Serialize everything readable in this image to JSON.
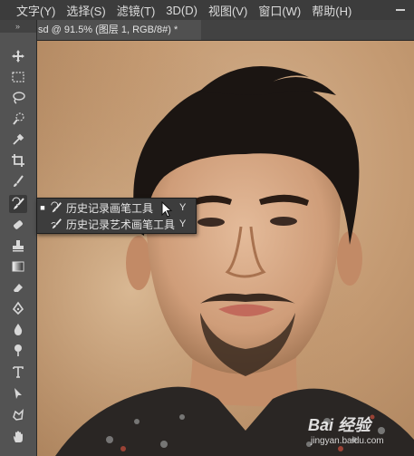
{
  "menubar": {
    "items": [
      "文字(Y)",
      "选择(S)",
      "滤镜(T)",
      "3D(D)",
      "视图(V)",
      "窗口(W)",
      "帮助(H)"
    ]
  },
  "document": {
    "tab_title": "sd @ 91.5% (图层 1, RGB/8#) *"
  },
  "toolbar": {
    "grip": "»",
    "tools": [
      "move-tool",
      "marquee-tool",
      "lasso-tool",
      "quick-select-tool",
      "eyedropper-tool",
      "crop-tool",
      "brush-tool",
      "history-brush-tool",
      "eraser-tool",
      "stamp-tool",
      "gradient-tool",
      "eraser-tool-2",
      "pen-tool",
      "blur-tool",
      "dodge-tool",
      "type-tool",
      "path-select-tool",
      "shape-tool",
      "hand-tool"
    ]
  },
  "flyout": {
    "items": [
      {
        "label": "历史记录画笔工具",
        "shortcut": "Y",
        "selected": true,
        "icon": "history-brush-icon"
      },
      {
        "label": "历史记录艺术画笔工具",
        "shortcut": "Y",
        "selected": false,
        "icon": "art-history-brush-icon"
      }
    ]
  },
  "watermark": {
    "main": "Bai 经验",
    "sub": "jingyan.baidu.com"
  },
  "colors": {
    "menubar_bg": "#3c3c3c",
    "toolbar_bg": "#535353",
    "flyout_bg": "#3d3d3d",
    "canvas_bg": "#c49a72"
  }
}
